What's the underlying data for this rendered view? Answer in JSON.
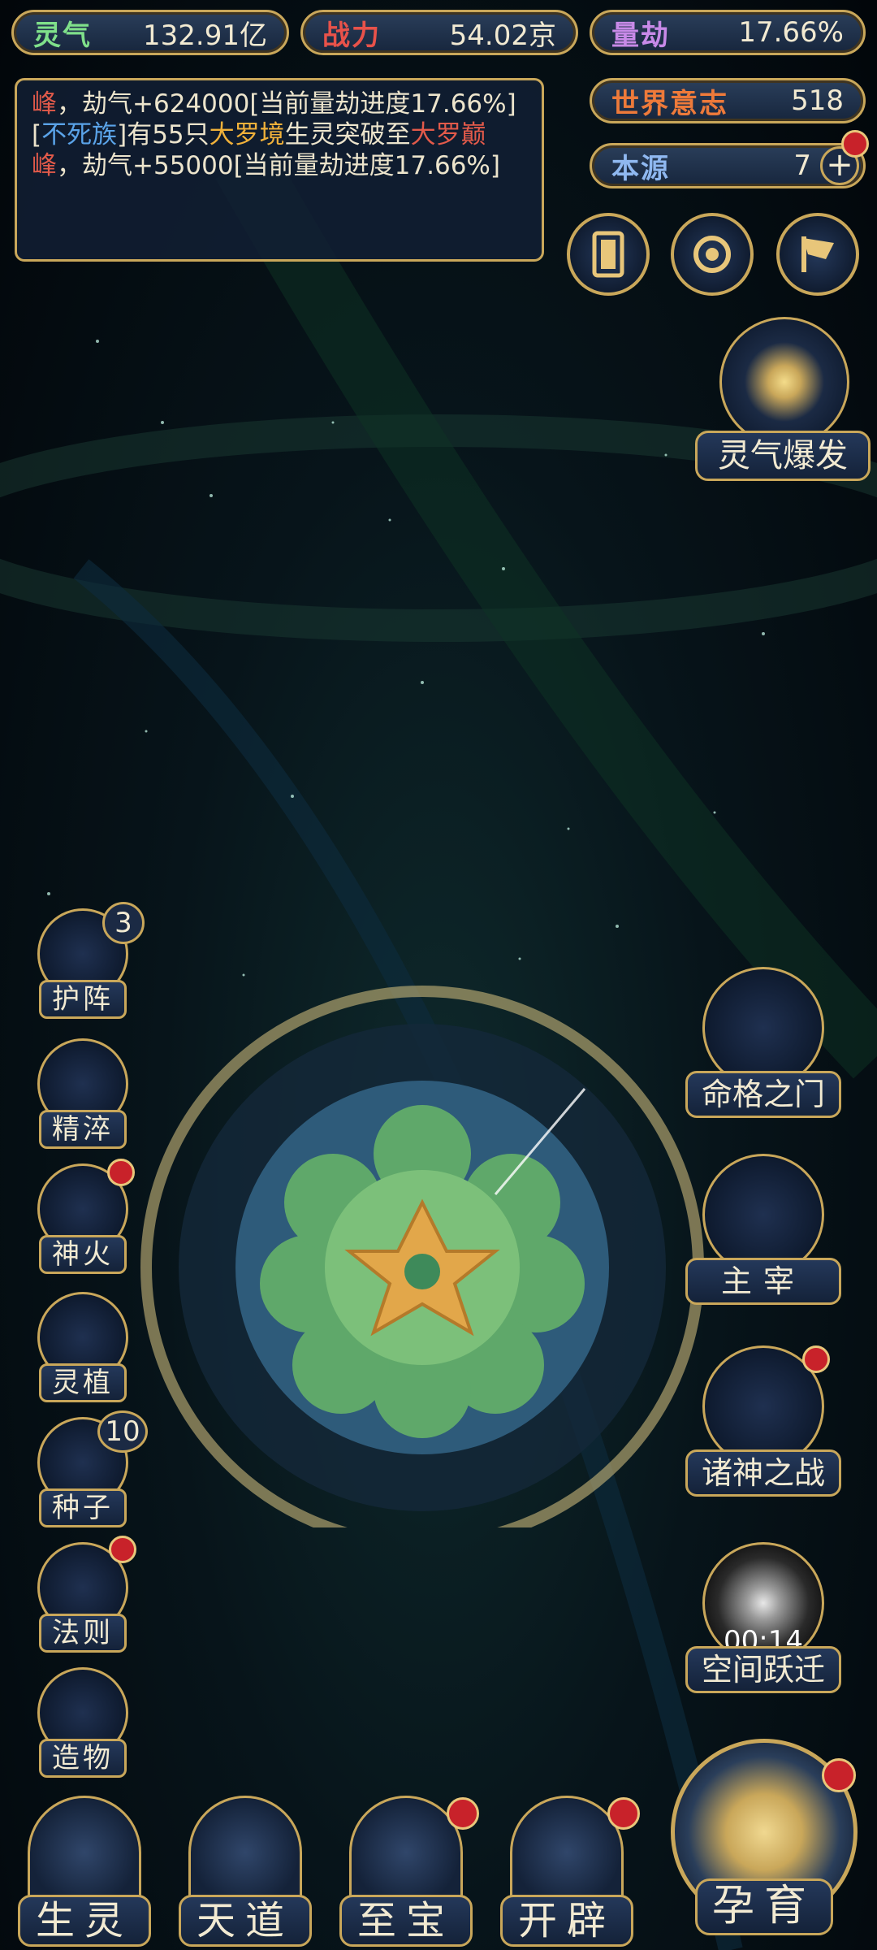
{
  "stats": {
    "lingqi": {
      "label": "灵气",
      "value": "132.91亿",
      "color": "#7fe08a"
    },
    "zhanli": {
      "label": "战力",
      "value": "54.02京",
      "color": "#e8524a"
    },
    "liangjie": {
      "label": "量劫",
      "value": "17.66%",
      "color": "#c88ae8"
    },
    "shijie": {
      "label": "世界意志",
      "value": "518",
      "color": "#ee7a3a"
    },
    "benyuan": {
      "label": "本源",
      "value": "7",
      "color": "#8fb8f0"
    }
  },
  "log": {
    "line1": {
      "a": "峰",
      "b": "，劫气+624000[当前量劫进度17.66%]"
    },
    "line2": {
      "open": "[",
      "race": "不死族",
      "mid": "]有55只",
      "realm": "大罗境",
      "mid2": "生灵突破至",
      "target": "大罗巅峰",
      "tail": "，劫气+55000[当前量劫进度17.66%]"
    }
  },
  "top_buttons": {
    "burst_label": "灵气爆发"
  },
  "left_menu": [
    {
      "label": "护阵",
      "badge": "3"
    },
    {
      "label": "精淬"
    },
    {
      "label": "神火"
    },
    {
      "label": "灵植"
    },
    {
      "label": "种子",
      "badge": "10"
    },
    {
      "label": "法则"
    },
    {
      "label": "造物"
    }
  ],
  "right_menu": [
    {
      "label": "命格之门"
    },
    {
      "label": "主宰"
    },
    {
      "label": "诸神之战"
    },
    {
      "label": "空间跃迁",
      "timer": "00:14"
    }
  ],
  "bottom_nav": [
    {
      "label": "生灵"
    },
    {
      "label": "天道"
    },
    {
      "label": "至宝"
    },
    {
      "label": "开辟"
    }
  ],
  "main_action": {
    "label": "孕育"
  },
  "colors": {
    "gold": "#c9a75a",
    "panel": "#1b2a44",
    "alert": "#c8222a"
  }
}
